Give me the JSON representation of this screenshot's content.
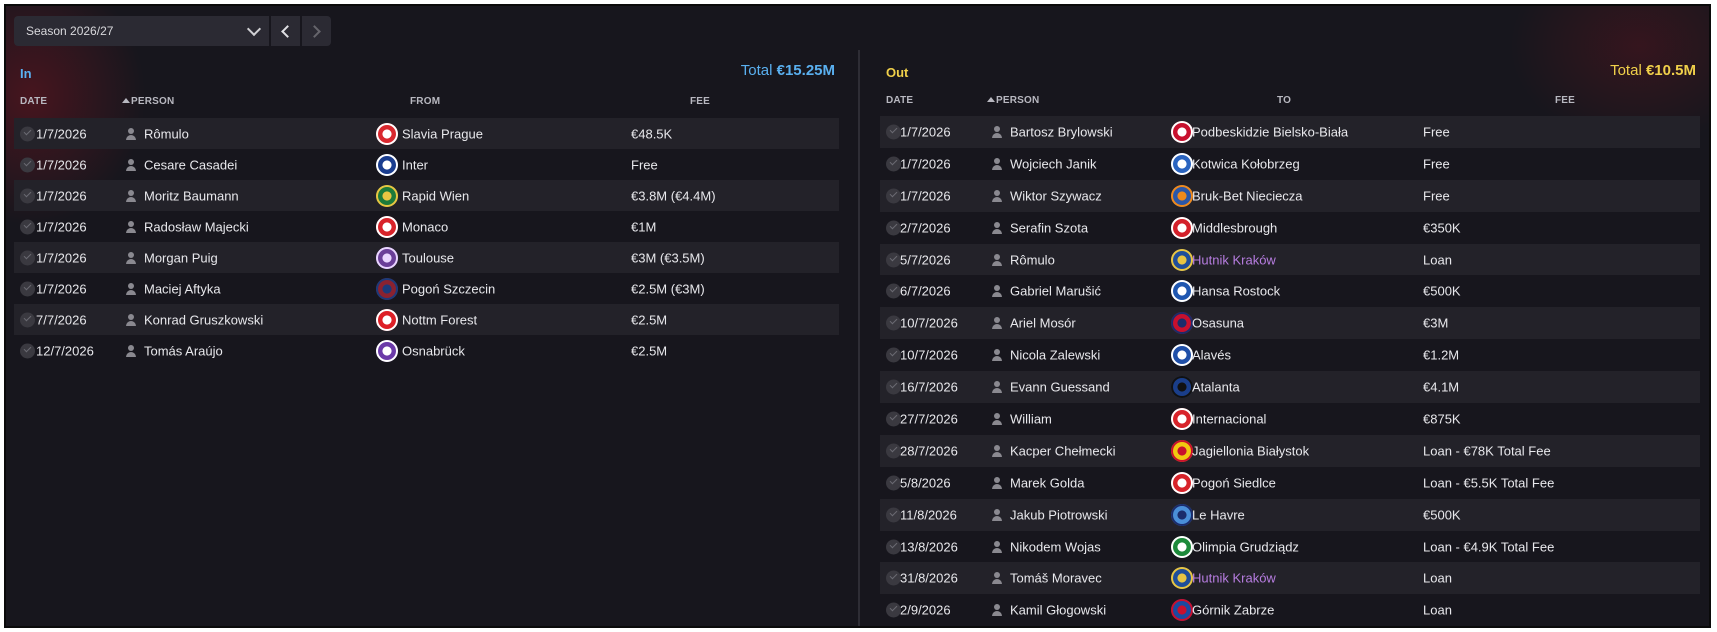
{
  "toolbar": {
    "season_label": "Season 2026/27",
    "icons": [
      "chevron-down-icon",
      "chevron-left-icon",
      "chevron-right-icon"
    ]
  },
  "colors": {
    "in_accent": "#5ab0f0",
    "out_accent": "#f0d04a",
    "loan_link": "#b77de0",
    "background": "#17161d"
  },
  "in_panel": {
    "title": "In",
    "total_label": "Total",
    "total_value": "€15.25M",
    "columns": {
      "date": "DATE",
      "person": "PERSON",
      "from": "FROM",
      "fee": "FEE"
    },
    "rows": [
      {
        "date": "1/7/2026",
        "person": "Rômulo",
        "club": "Slavia Prague",
        "fee": "€48.5K",
        "crest": "#d9282f",
        "crest2": "#ffffff"
      },
      {
        "date": "1/7/2026",
        "person": "Cesare Casadei",
        "club": "Inter",
        "fee": "Free",
        "crest": "#1a3d8f",
        "crest2": "#ffffff"
      },
      {
        "date": "1/7/2026",
        "person": "Moritz Baumann",
        "club": "Rapid Wien",
        "fee": "€3.8M (€4.4M)",
        "crest": "#1c7a3a",
        "crest2": "#e8c542"
      },
      {
        "date": "1/7/2026",
        "person": "Radosław Majecki",
        "club": "Monaco",
        "fee": "€1M",
        "crest": "#d8232a",
        "crest2": "#ffffff"
      },
      {
        "date": "1/7/2026",
        "person": "Morgan Puig",
        "club": "Toulouse",
        "fee": "€3M (€3.5M)",
        "crest": "#6a3e98",
        "crest2": "#e9d6ff"
      },
      {
        "date": "1/7/2026",
        "person": "Maciej Aftyka",
        "club": "Pogoń Szczecin",
        "fee": "€2.5M (€3M)",
        "crest": "#8a2230",
        "crest2": "#1b3a7a"
      },
      {
        "date": "7/7/2026",
        "person": "Konrad Gruszkowski",
        "club": "Nottm Forest",
        "fee": "€2.5M",
        "crest": "#dd1f26",
        "crest2": "#ffffff"
      },
      {
        "date": "12/7/2026",
        "person": "Tomás Araújo",
        "club": "Osnabrück",
        "fee": "€2.5M",
        "crest": "#6b3aa8",
        "crest2": "#ffffff"
      }
    ]
  },
  "out_panel": {
    "title": "Out",
    "total_label": "Total",
    "total_value": "€10.5M",
    "columns": {
      "date": "DATE",
      "person": "PERSON",
      "to": "TO",
      "fee": "FEE"
    },
    "rows": [
      {
        "date": "1/7/2026",
        "person": "Bartosz Brylowski",
        "club": "Podbeskidzie Bielsko-Biała",
        "fee": "Free",
        "crest": "#c8102e",
        "crest2": "#ffffff"
      },
      {
        "date": "1/7/2026",
        "person": "Wojciech Janik",
        "club": "Kotwica Kołobrzeg",
        "fee": "Free",
        "crest": "#2a64c0",
        "crest2": "#ffffff"
      },
      {
        "date": "1/7/2026",
        "person": "Wiktor Szywacz",
        "club": "Bruk-Bet Nieciecza",
        "fee": "Free",
        "crest": "#2b57a8",
        "crest2": "#f08a1c"
      },
      {
        "date": "2/7/2026",
        "person": "Serafin Szota",
        "club": "Middlesbrough",
        "fee": "€350K",
        "crest": "#d4202a",
        "crest2": "#ffffff"
      },
      {
        "date": "5/7/2026",
        "person": "Rômulo",
        "club": "Hutnik Kraków",
        "fee": "Loan",
        "crest": "#1f4e9a",
        "crest2": "#e8c542",
        "link": true
      },
      {
        "date": "6/7/2026",
        "person": "Gabriel Marušić",
        "club": "Hansa Rostock",
        "fee": "€500K",
        "crest": "#1e56b0",
        "crest2": "#ffffff"
      },
      {
        "date": "10/7/2026",
        "person": "Ariel Mosór",
        "club": "Osasuna",
        "fee": "€3M",
        "crest": "#c8102e",
        "crest2": "#1b2c6b"
      },
      {
        "date": "10/7/2026",
        "person": "Nicola Zalewski",
        "club": "Alavés",
        "fee": "€1.2M",
        "crest": "#1f4fa8",
        "crest2": "#ffffff"
      },
      {
        "date": "16/7/2026",
        "person": "Evann Guessand",
        "club": "Atalanta",
        "fee": "€4.1M",
        "crest": "#1a3e8a",
        "crest2": "#111111"
      },
      {
        "date": "27/7/2026",
        "person": "William",
        "club": "Internacional",
        "fee": "€875K",
        "crest": "#d8232a",
        "crest2": "#ffffff"
      },
      {
        "date": "28/7/2026",
        "person": "Kacper Chełmecki",
        "club": "Jagiellonia Białystok",
        "fee": "Loan - €78K Total Fee",
        "crest": "#f2c80f",
        "crest2": "#c8102e"
      },
      {
        "date": "5/8/2026",
        "person": "Marek Golda",
        "club": "Pogoń Siedlce",
        "fee": "Loan - €5.5K Total Fee",
        "crest": "#d8232a",
        "crest2": "#ffffff"
      },
      {
        "date": "11/8/2026",
        "person": "Jakub Piotrowski",
        "club": "Le Havre",
        "fee": "€500K",
        "crest": "#4a8fd8",
        "crest2": "#1b2c6b"
      },
      {
        "date": "13/8/2026",
        "person": "Nikodem Wojas",
        "club": "Olimpia Grudziądz",
        "fee": "Loan - €4.9K Total Fee",
        "crest": "#1c8a3a",
        "crest2": "#ffffff"
      },
      {
        "date": "31/8/2026",
        "person": "Tomáš Moravec",
        "club": "Hutnik Kraków",
        "fee": "Loan",
        "crest": "#1f4e9a",
        "crest2": "#e8c542",
        "link": true
      },
      {
        "date": "2/9/2026",
        "person": "Kamil Głogowski",
        "club": "Górnik Zabrze",
        "fee": "Loan",
        "crest": "#1b4aa0",
        "crest2": "#c8102e"
      }
    ]
  }
}
